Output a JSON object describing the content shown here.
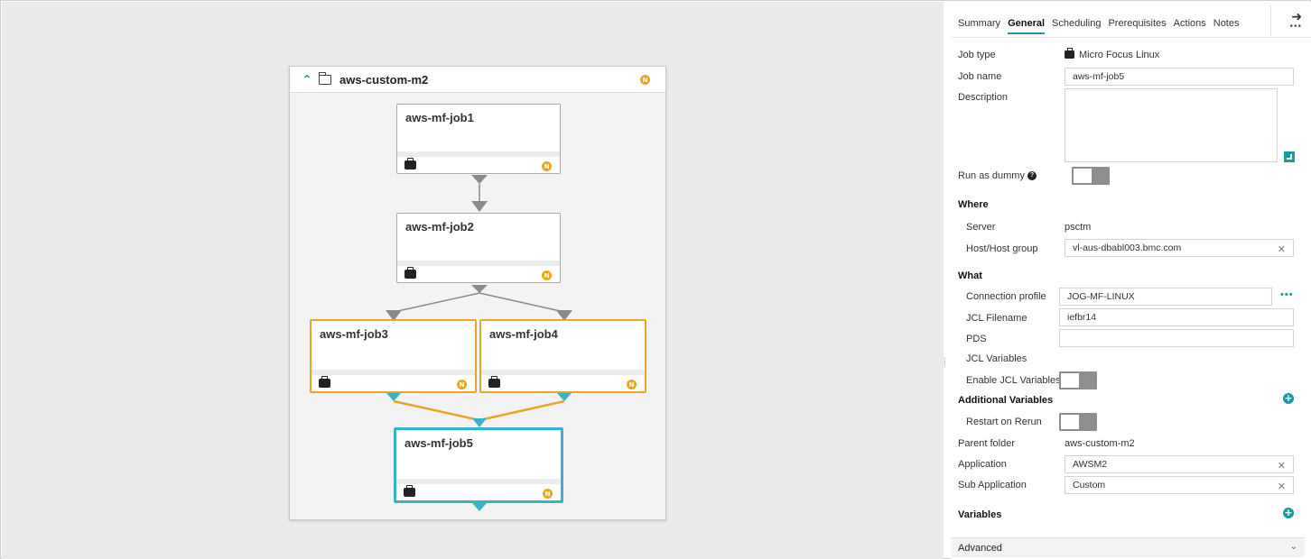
{
  "canvas": {
    "folder": {
      "name": "aws-custom-m2",
      "badge": "N"
    },
    "jobs": [
      {
        "name": "aws-mf-job1",
        "badge": "N"
      },
      {
        "name": "aws-mf-job2",
        "badge": "N"
      },
      {
        "name": "aws-mf-job3",
        "badge": "N"
      },
      {
        "name": "aws-mf-job4",
        "badge": "N"
      },
      {
        "name": "aws-mf-job5",
        "badge": "N"
      }
    ]
  },
  "panel": {
    "tabs": [
      "Summary",
      "General",
      "Scheduling",
      "Prerequisites",
      "Actions",
      "Notes"
    ],
    "active_tab": "General",
    "job_type_label": "Job type",
    "job_type_value": "Micro Focus Linux",
    "job_name_label": "Job name",
    "job_name_value": "aws-mf-job5",
    "description_label": "Description",
    "run_as_dummy_label": "Run as dummy",
    "where_label": "Where",
    "server_label": "Server",
    "server_value": "psctm",
    "host_label": "Host/Host group",
    "host_value": "vl-aus-dbabl003.bmc.com",
    "what_label": "What",
    "conn_profile_label": "Connection profile",
    "conn_profile_value": "JOG-MF-LINUX",
    "jcl_filename_label": "JCL Filename",
    "jcl_filename_value": "iefbr14",
    "pds_label": "PDS",
    "pds_value": "",
    "jcl_variables_label": "JCL Variables",
    "enable_jcl_label": "Enable JCL Variables",
    "additional_vars_label": "Additional Variables",
    "restart_label": "Restart on Rerun",
    "parent_folder_label": "Parent folder",
    "parent_folder_value": "aws-custom-m2",
    "application_label": "Application",
    "application_value": "AWSM2",
    "sub_application_label": "Sub Application",
    "sub_application_value": "Custom",
    "variables_label": "Variables",
    "advanced_label": "Advanced"
  },
  "colors": {
    "accent": "#1a9aa0",
    "warning": "#e9a81b",
    "selected": "#3ab3c8",
    "group": "#e9a42c"
  }
}
